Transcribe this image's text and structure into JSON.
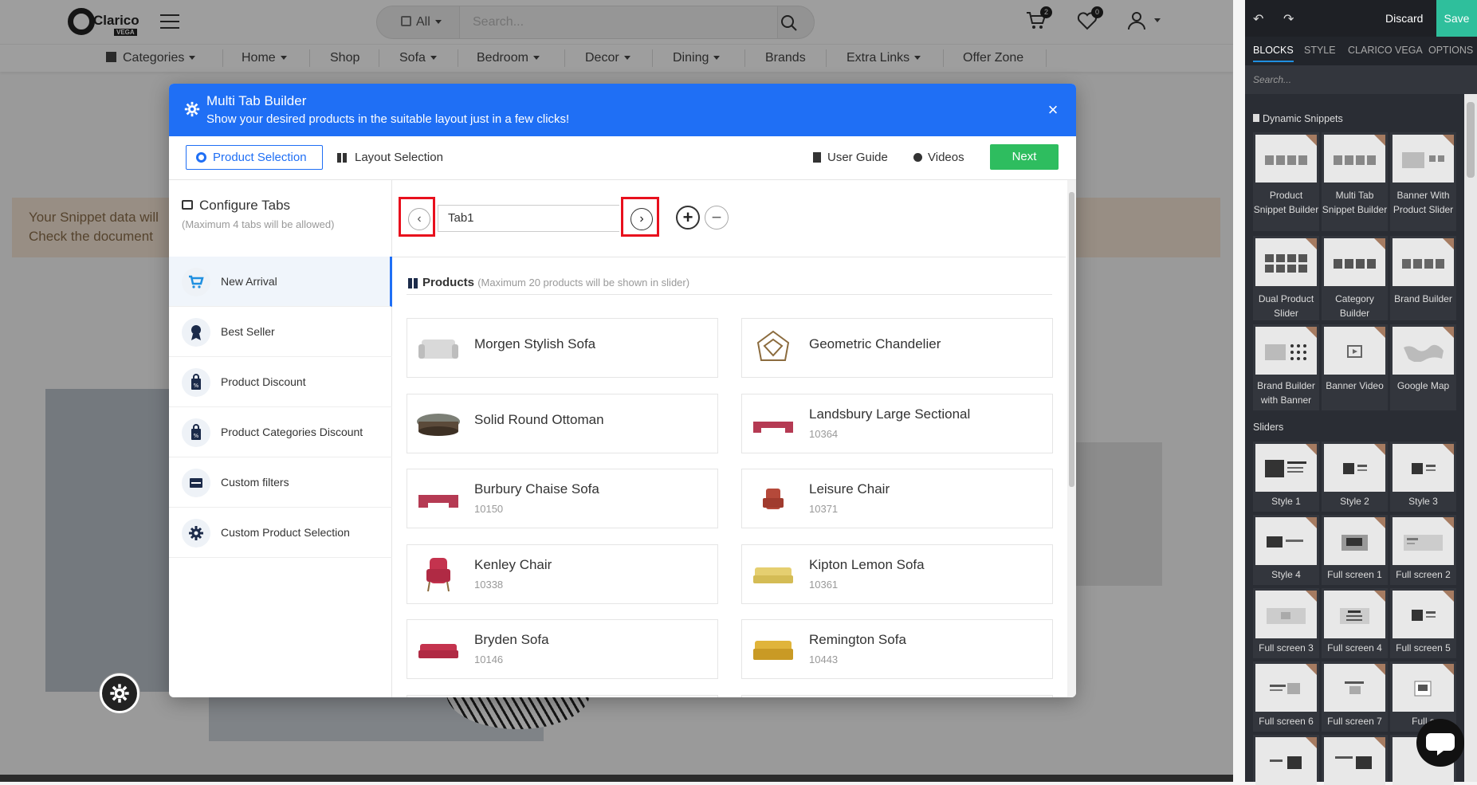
{
  "site": {
    "logo_text": "Clarico",
    "logo_sub": "VEGA",
    "search_category": "All",
    "search_placeholder": "Search...",
    "cart_count": "2",
    "wishlist_count": "0",
    "nav": [
      "Categories",
      "Home",
      "Shop",
      "Sofa",
      "Bedroom",
      "Decor",
      "Dining",
      "Brands",
      "Extra Links",
      "Offer Zone"
    ],
    "notice_line1": "Your Snippet data will",
    "notice_line2": "Check the document"
  },
  "modal": {
    "title": "Multi Tab Builder",
    "subtitle": "Show your desired products in the suitable layout just in a few clicks!",
    "close": "×",
    "tab_product": "Product Selection",
    "tab_layout": "Layout Selection",
    "user_guide": "User Guide",
    "videos": "Videos",
    "next": "Next",
    "configure_title": "Configure Tabs",
    "configure_sub": "(Maximum 4 tabs will be allowed)",
    "menu": [
      "New Arrival",
      "Best Seller",
      "Product Discount",
      "Product Categories Discount",
      "Custom filters",
      "Custom Product Selection"
    ],
    "tab_name": "Tab1",
    "products_title": "Products",
    "products_sub": "(Maximum 20 products will be shown in slider)",
    "products": [
      {
        "name": "Morgen Stylish Sofa",
        "code": ""
      },
      {
        "name": "Geometric Chandelier",
        "code": ""
      },
      {
        "name": "Solid Round Ottoman",
        "code": ""
      },
      {
        "name": "Landsbury Large Sectional",
        "code": "10364"
      },
      {
        "name": "Burbury Chaise Sofa",
        "code": "10150"
      },
      {
        "name": "Leisure Chair",
        "code": "10371"
      },
      {
        "name": "Kenley Chair",
        "code": "10338"
      },
      {
        "name": "Kipton Lemon Sofa",
        "code": "10361"
      },
      {
        "name": "Bryden Sofa",
        "code": "10146"
      },
      {
        "name": "Remington Sofa",
        "code": "10443"
      }
    ]
  },
  "panel": {
    "discard": "Discard",
    "save": "Save",
    "tabs": [
      "BLOCKS",
      "STYLE",
      "CLARICO VEGA",
      "OPTIONS"
    ],
    "search_placeholder": "Search...",
    "section_dynamic": "Dynamic Snippets",
    "section_sliders": "Sliders",
    "dynamic": [
      "Product Snippet Builder",
      "Multi Tab Snippet Builder",
      "Banner With Product Slider",
      "Dual Product Slider",
      "Category Builder",
      "Brand Builder",
      "Brand Builder with Banner",
      "Banner Video",
      "Google Map"
    ],
    "sliders": [
      "Style 1",
      "Style 2",
      "Style 3",
      "Style 4",
      "Full screen 1",
      "Full screen 2",
      "Full screen 3",
      "Full screen 4",
      "Full screen 5",
      "Full screen 6",
      "Full screen 7",
      "Full s"
    ]
  },
  "colors": {
    "primary": "#1f6ff5",
    "success": "#2ebd5f",
    "highlight": "#e8101d",
    "panel": "#2a2d34"
  }
}
